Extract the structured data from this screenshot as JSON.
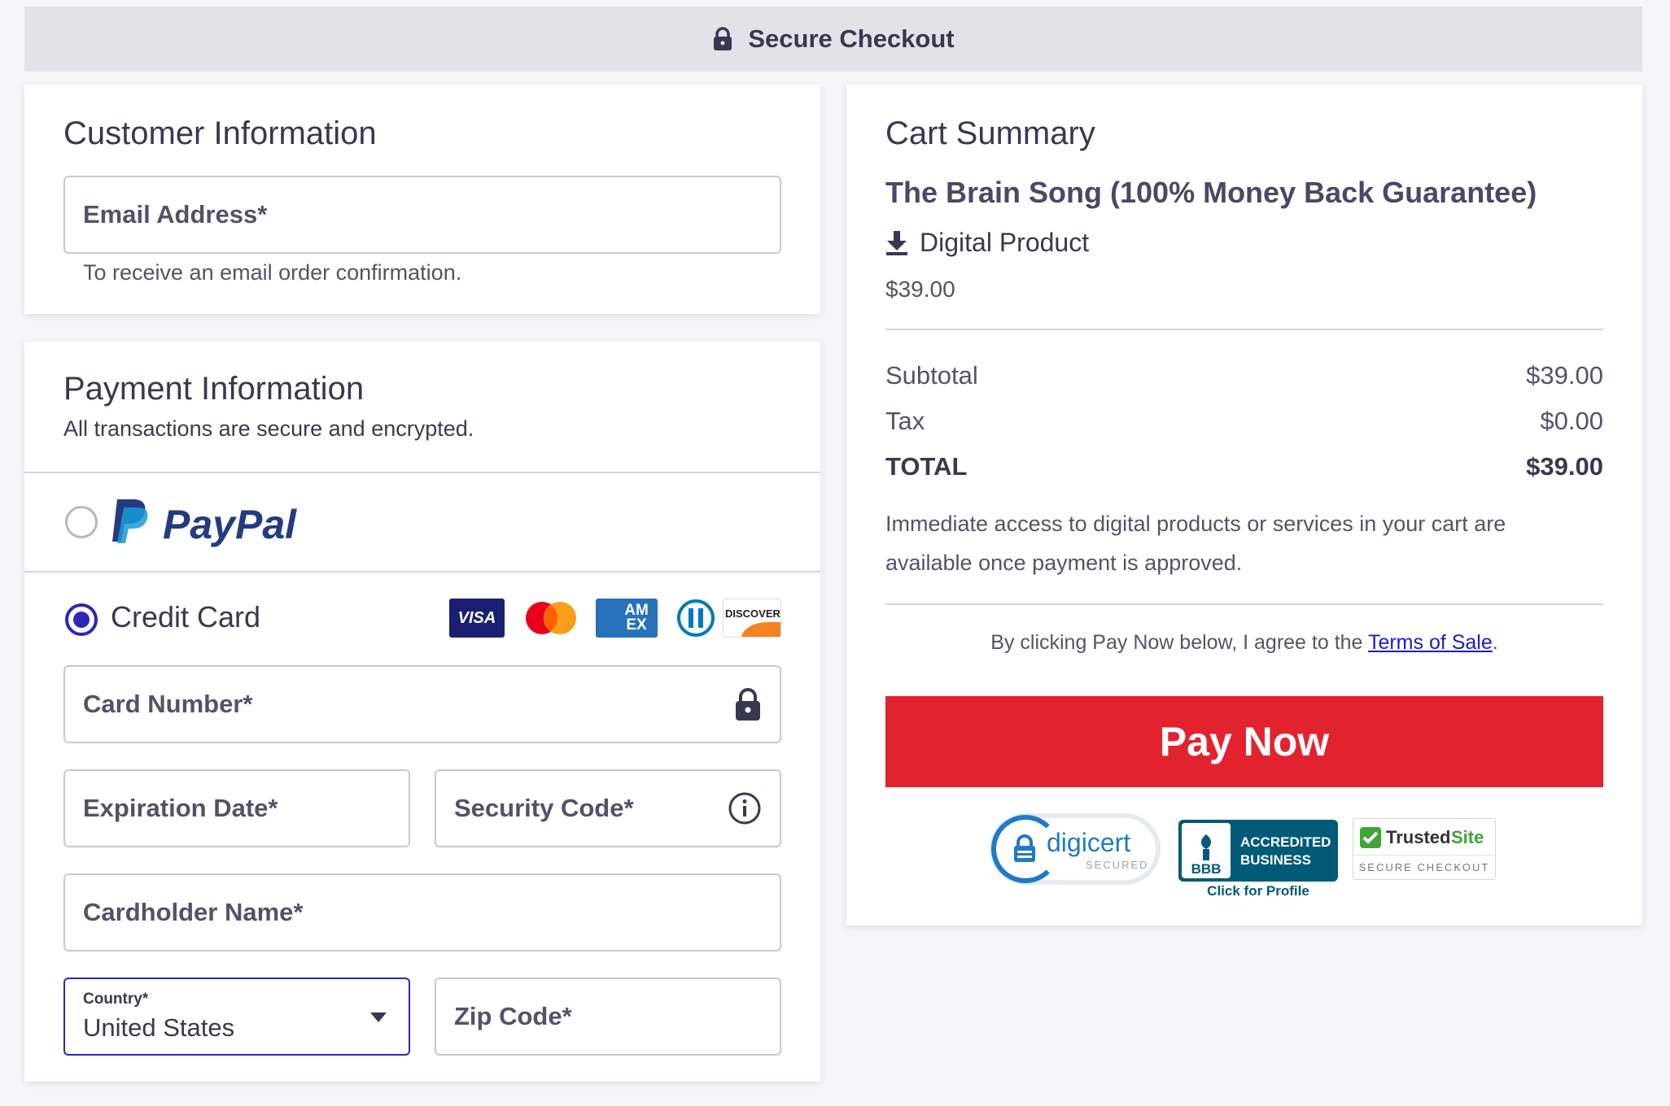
{
  "header": {
    "title": "Secure Checkout",
    "icon": "lock-icon"
  },
  "customer": {
    "title": "Customer Information",
    "email_label": "Email Address*",
    "email_helper": "To receive an email order confirmation."
  },
  "payment": {
    "title": "Payment Information",
    "subtitle": "All transactions are secure and encrypted.",
    "paypal_label": "PayPal",
    "paypal_selected": false,
    "credit_card_label": "Credit Card",
    "credit_card_selected": true,
    "card_brands": [
      "VISA",
      "mastercard",
      "AM EX",
      "diners",
      "DISCOVER"
    ],
    "card_number_label": "Card Number*",
    "expiration_label": "Expiration Date*",
    "security_code_label": "Security Code*",
    "cardholder_label": "Cardholder Name*",
    "country_label": "Country*",
    "country_value": "United States",
    "zip_label": "Zip Code*"
  },
  "cart": {
    "title": "Cart Summary",
    "product_name": "The Brain Song (100% Money Back Guarantee)",
    "product_type": "Digital Product",
    "product_price": "$39.00",
    "subtotal_label": "Subtotal",
    "subtotal_value": "$39.00",
    "tax_label": "Tax",
    "tax_value": "$0.00",
    "total_label": "TOTAL",
    "total_value": "$39.00",
    "access_note": "Immediate access to digital products or services in your cart are available once payment is approved.",
    "agree_prefix": "By clicking Pay Now below, I agree to the ",
    "terms_link": "Terms of Sale",
    "agree_suffix": ".",
    "pay_button": "Pay Now"
  },
  "trust_badges": {
    "digicert": {
      "name": "digicert",
      "sub": "SECURED"
    },
    "bbb": {
      "logo": "BBB",
      "line1": "ACCREDITED",
      "line2": "BUSINESS",
      "caption": "Click for Profile"
    },
    "trustedsite": {
      "name_a": "Trusted",
      "name_b": "Site",
      "sub": "SECURE CHECKOUT"
    }
  },
  "colors": {
    "accent": "#2e26b8",
    "pay_button": "#e3222f",
    "link": "#1a1ad0",
    "text": "#3c3a52"
  }
}
